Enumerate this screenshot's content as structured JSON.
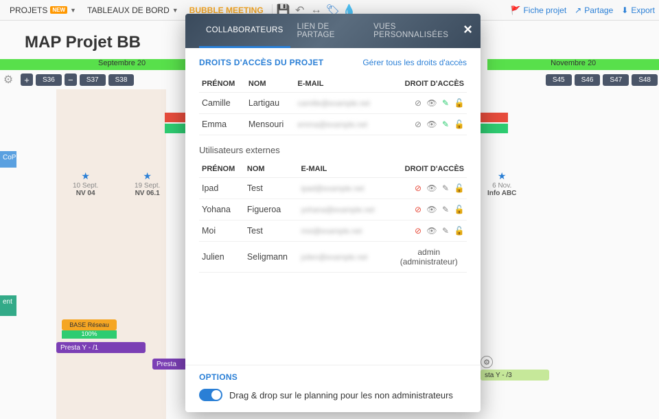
{
  "toolbar": {
    "projects": "PROJETS",
    "badge_new": "NEW",
    "dashboards": "TABLEAUX DE BORD",
    "bubble_meeting": "BUBBLE MEETING",
    "fiche_projet": "Fiche projet",
    "partage": "Partage",
    "export": "Export"
  },
  "project": {
    "title": "MAP Projet BB"
  },
  "months": [
    "Septembre 20",
    "Novembre 20"
  ],
  "weeks": [
    "S36",
    "S37",
    "S38",
    "S45",
    "S46",
    "S47",
    "S48"
  ],
  "markers": [
    {
      "date": "10 Sept.",
      "label": "NV 04"
    },
    {
      "date": "19 Sept.",
      "label": "NV 06.1"
    },
    {
      "date": "6 Nov.",
      "label": "Info ABC"
    }
  ],
  "sidebar_labels": {
    "copil": "CoPil",
    "ent": "ent"
  },
  "bars": {
    "base": "BASE Réseau",
    "pct": "100%",
    "presta1": "Presta Y - /1",
    "presta": "Presta",
    "sta3": "sta Y - /3"
  },
  "modal": {
    "tabs": [
      "COLLABORATEURS",
      "LIEN DE PARTAGE",
      "VUES PERSONNALISÉES"
    ],
    "section_title": "DROITS D'ACCÈS DU PROJET",
    "manage_link": "Gérer tous les droits d'accès",
    "columns": {
      "firstname": "PRÉNOM",
      "lastname": "NOM",
      "email": "E-MAIL",
      "access": "DROIT D'ACCÈS"
    },
    "collaborators": [
      {
        "firstname": "Camille",
        "lastname": "Lartigau",
        "email": "camille@example.net"
      },
      {
        "firstname": "Emma",
        "lastname": "Mensouri",
        "email": "emma@example.net"
      }
    ],
    "external_title": "Utilisateurs externes",
    "externals": [
      {
        "firstname": "Ipad",
        "lastname": "Test",
        "email": "ipad@example.net",
        "ban_red": true
      },
      {
        "firstname": "Yohana",
        "lastname": "Figueroa",
        "email": "yohana@example.net",
        "ban_red": true
      },
      {
        "firstname": "Moi",
        "lastname": "Test",
        "email": "moi@example.net",
        "ban_red": true
      }
    ],
    "admin_user": {
      "firstname": "Julien",
      "lastname": "Seligmann",
      "email": "julien@example.net",
      "role_line1": "admin",
      "role_line2": "(administrateur)"
    },
    "options_title": "OPTIONS",
    "toggle_label": "Drag & drop sur le planning pour les non administrateurs"
  }
}
